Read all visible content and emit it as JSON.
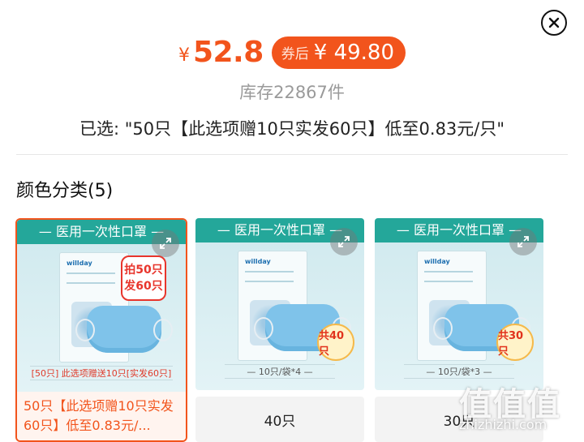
{
  "header": {
    "yen_symbol": "¥",
    "price": "52.8",
    "coupon_label": "券后",
    "coupon_price": "¥ 49.80",
    "stock": "库存22867件",
    "selected": "已选: \"50只【此选项赠10只实发60只】低至0.83元/只\""
  },
  "section": {
    "title": "颜色分类(5)"
  },
  "cards": [
    {
      "banner": "— 医用一次性口罩 —",
      "img_label": "[50只] 此选项赠送10只[实发60只]",
      "badge": "拍50只\n发60只",
      "caption": "50只【此选项赠10只实发60只】低至0.83元/..."
    },
    {
      "banner": "— 医用一次性口罩 —",
      "img_label": "— 10只/袋*4 —",
      "badge": "共40只",
      "caption": "40只"
    },
    {
      "banner": "— 医用一次性口罩 —",
      "img_label": "— 10只/袋*3 —",
      "badge": "共30只",
      "caption": "30只"
    }
  ],
  "package_logo": "willday",
  "watermark": {
    "main": "值值值",
    "sub": "zhizhizhi.com"
  },
  "colors": {
    "accent": "#f2541c",
    "banner": "#24a79a"
  },
  "icons": {
    "close": "close-icon",
    "expand": "expand-icon"
  }
}
